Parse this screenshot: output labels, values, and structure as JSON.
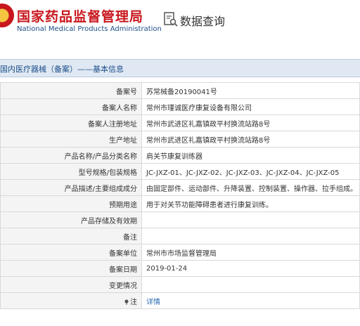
{
  "header": {
    "title": "国家药品监督管理局",
    "subtitle": "National Medical Products Administration",
    "query_label": "数据查询"
  },
  "section": {
    "title": "国内医疗器械（备案）——基本信息"
  },
  "rows": [
    {
      "label": "备案号",
      "value": "苏常械备20190041号"
    },
    {
      "label": "备案人名称",
      "value": "常州市瑾诚医疗康复设备有限公司"
    },
    {
      "label": "备案人注册地址",
      "value": "常州市武进区礼嘉镇政平村换流站路8号"
    },
    {
      "label": "生产地址",
      "value": "常州市武进区礼嘉镇政平村换流站路8号"
    },
    {
      "label": "产品名称/产品分类名称",
      "value": "肩关节康复训练器"
    },
    {
      "label": "型号规格/包装规格",
      "value": "JC-JXZ-01、JC-JXZ-02、JC-JXZ-03、JC-JXZ-04、JC-JXZ-05"
    },
    {
      "label": "产品描述/主要组成成分",
      "value": "由固定部件、运动部件、升降装置、控制装置、操作器、拉手组成。"
    },
    {
      "label": "预期用途",
      "value": "用于对关节功能障碍患者进行康复训练。"
    },
    {
      "label": "产品存储及有效期",
      "value": ""
    },
    {
      "label": "备注",
      "value": ""
    },
    {
      "label": "备案单位",
      "value": "常州市市场监督管理局"
    },
    {
      "label": "备案日期",
      "value": "2019-01-24"
    },
    {
      "label": "变更情况",
      "value": ""
    }
  ],
  "footer_row": {
    "label": "注",
    "link": "详情"
  }
}
